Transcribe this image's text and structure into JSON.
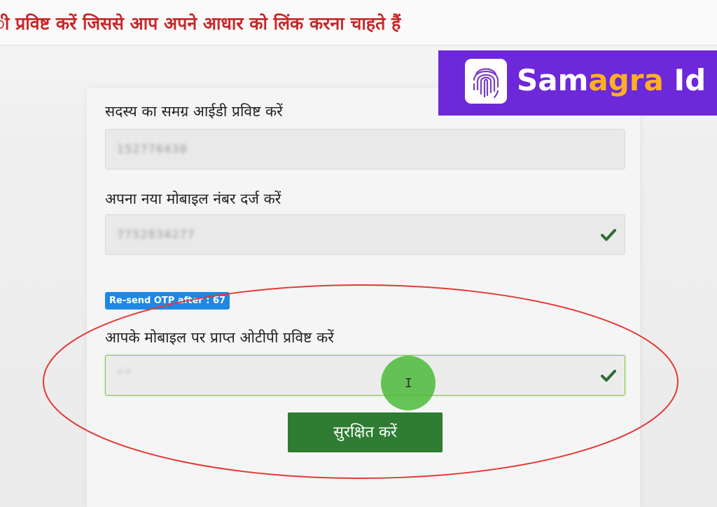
{
  "banner": {
    "text": "ी प्रविष्ट करें जिससे आप अपने आधार को लिंक करना चाहते हैं"
  },
  "logo": {
    "icon": "fingerprint-icon",
    "part1": "Sam",
    "part2": "agra",
    "part3": " Id"
  },
  "form": {
    "samagra_label": "सदस्य का समग्र आईडी प्रविष्ट करें",
    "samagra_value": "152776438",
    "mobile_label": "अपना नया मोबाइल नंबर दर्ज करें",
    "mobile_value": "7752834277",
    "otp_badge": "Re-send OTP after : 67",
    "otp_label": "आपके मोबाइल पर प्राप्त ओटीपी प्रविष्ट करें",
    "otp_value": "**",
    "save_label": "सुरक्षित करें"
  },
  "cursor": {
    "icon": "text-cursor-icon",
    "glyph": "I"
  },
  "colors": {
    "banner_text": "#c62828",
    "logo_bg": "#6d28d9",
    "logo_accent": "#ffb020",
    "badge_bg": "#1e88e5",
    "button_bg": "#2e7d32",
    "check": "#2e6b35",
    "annotation": "#e53935"
  }
}
